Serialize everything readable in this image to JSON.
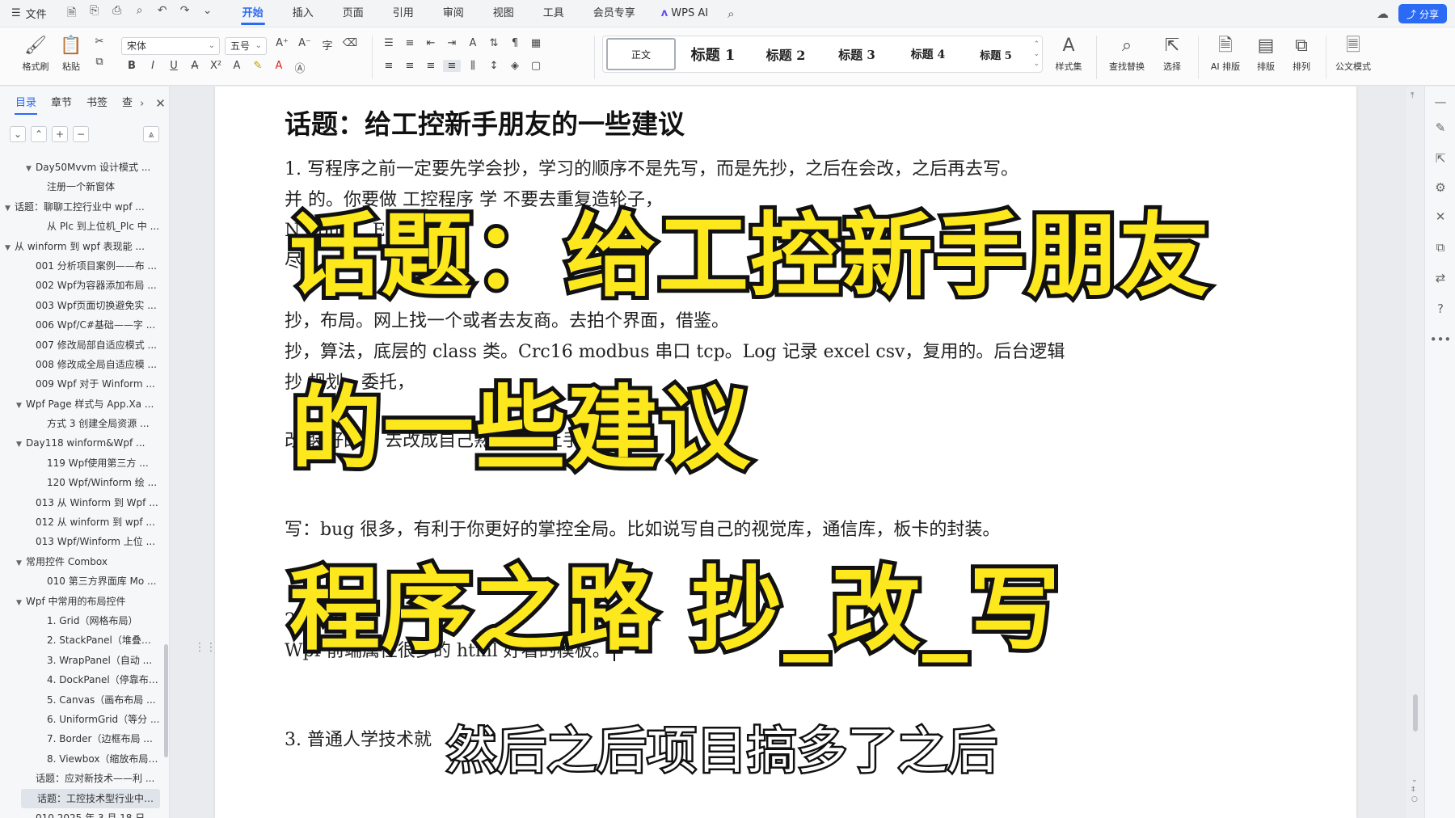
{
  "menubar": {
    "file_label": "文件",
    "tabs": [
      "开始",
      "插入",
      "页面",
      "引用",
      "审阅",
      "视图",
      "工具",
      "会员专享"
    ],
    "active_tab": "开始",
    "wps_ai_label": "WPS AI",
    "share_label": "分享"
  },
  "ribbon": {
    "format_painter": "格式刷",
    "paste": "粘贴",
    "font_name": "宋体",
    "font_size": "五号",
    "styles": [
      "正文",
      "标题 1",
      "标题 2",
      "标题 3",
      "标题 4",
      "标题 5"
    ],
    "style_set": "样式集",
    "find_replace": "查找替换",
    "select": "选择",
    "ai_layout": "AI 排版",
    "layout": "排版",
    "arrange": "排列",
    "official_mode": "公文模式"
  },
  "left_panel": {
    "tabs": [
      "目录",
      "章节",
      "书签",
      "查"
    ],
    "active_tab": "目录",
    "toc": [
      {
        "label": "Day50Mvvm 设计模式 ...",
        "level": 3,
        "expanded": true
      },
      {
        "label": "注册一个新窗体",
        "level": 4
      },
      {
        "label": "话题：聊聊工控行业中 wpf ...",
        "level": 1,
        "expanded": true
      },
      {
        "label": "从 Plc 到上位机_Plc 中 ...",
        "level": 4
      },
      {
        "label": "从 winform 到 wpf 表现能 ...",
        "level": 1,
        "expanded": true
      },
      {
        "label": "001 分析项目案例——布 ...",
        "level": 3
      },
      {
        "label": "002 Wpf为容器添加布局 ...",
        "level": 3
      },
      {
        "label": "003 Wpf页面切换避免实 ...",
        "level": 3
      },
      {
        "label": "006 Wpf/C#基础——字 ...",
        "level": 3
      },
      {
        "label": "007 修改局部自适应模式 ...",
        "level": 3
      },
      {
        "label": "008 修改成全局自适应模 ...",
        "level": 3
      },
      {
        "label": "009 Wpf 对于 Winform ...",
        "level": 3
      },
      {
        "label": "Wpf Page 样式与 App.Xa ...",
        "level": 2,
        "expanded": true
      },
      {
        "label": "方式 3 创建全局资源 ...",
        "level": 4
      },
      {
        "label": "Day118 winform&Wpf ...",
        "level": 2,
        "expanded": true
      },
      {
        "label": "119 Wpf使用第三方 ...",
        "level": 4
      },
      {
        "label": "120 Wpf/Winform 绘 ...",
        "level": 4
      },
      {
        "label": "013 从 Winform 到 Wpf ...",
        "level": 3
      },
      {
        "label": "012 从 winform 到 wpf ...",
        "level": 3
      },
      {
        "label": "013 Wpf/Winform 上位 ...",
        "level": 3
      },
      {
        "label": "常用控件 Combox",
        "level": 2,
        "expanded": true
      },
      {
        "label": "010 第三方界面库 Mo ...",
        "level": 4
      },
      {
        "label": "Wpf 中常用的布局控件",
        "level": 2,
        "expanded": true
      },
      {
        "label": "1. Grid（网格布局）",
        "level": 4
      },
      {
        "label": "2. StackPanel（堆叠布 ...",
        "level": 4
      },
      {
        "label": "3. WrapPanel（自动 ...",
        "level": 4
      },
      {
        "label": "4. DockPanel（停靠布 ...",
        "level": 4
      },
      {
        "label": "5. Canvas（画布布局 ...",
        "level": 4
      },
      {
        "label": "6. UniformGrid（等分 ...",
        "level": 4
      },
      {
        "label": "7. Border（边框布局 ...",
        "level": 4
      },
      {
        "label": "8. Viewbox（缩放布局 ...",
        "level": 4
      },
      {
        "label": "话题：应对新技术——利 ...",
        "level": 3
      },
      {
        "label": "话题：工控技术型行业中 ...",
        "level": 3,
        "selected": true
      },
      {
        "label": "010 2025 年 3 月 18 日",
        "level": 3
      }
    ]
  },
  "document": {
    "title": "话题：给工控新手朋友的一些建议",
    "lines": [
      "1.  写程序之前一定要先学会抄，学习的顺序不是先写，而是先抄，之后在会改，之后再去写。",
      "并       的。你要做       工控程序       学       不要去重复造轮子，",
      "N         dbus，       E75",
      "尽",
      "抄，布局。网上找一个或者去友商。去拍个界面，借鉴。",
      "抄，算法，底层的 class 类。Crc16 modbus  串口  tcp。Log  记录 excel csv，复用的。后台逻辑",
      "抄      规划，委托，",
      "改      装好的东                  去改成自己熟悉容易上手的。",
      "写：bug 很多，有利于你更好的掌控全局。比如说写自己的视觉库，通信库，板卡的封装。",
      "2              者              式码",
      "Wpf  前端属性很多的  html  好看的模板。",
      "3.  普通人学技术就"
    ]
  },
  "overlay": {
    "line1": "话题：给工控新手朋友",
    "line2": "的一些建议",
    "line3": "程序之路 抄_改_写",
    "subtitle": "然后之后项目搞多了之后"
  }
}
